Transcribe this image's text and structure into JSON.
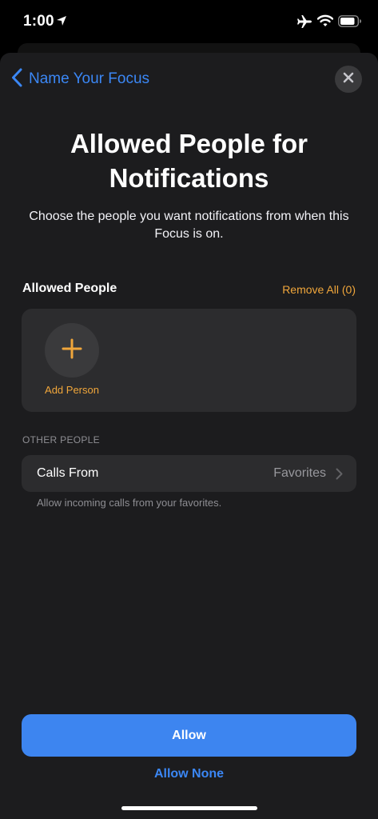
{
  "status_bar": {
    "time": "1:00",
    "icons": [
      "location-arrow-icon",
      "airplane-icon",
      "wifi-icon",
      "battery-icon"
    ]
  },
  "nav": {
    "back_label": "Name Your Focus",
    "back_icon": "chevron-left-icon",
    "close_icon": "close-icon"
  },
  "header": {
    "title": "Allowed People for Notifications",
    "subtitle": "Choose the people you want notifications from when this Focus is on."
  },
  "allowed_people": {
    "label": "Allowed People",
    "remove_all": "Remove All (0)",
    "add_person": "Add Person",
    "add_icon": "plus-icon"
  },
  "other_people": {
    "header": "OTHER PEOPLE",
    "calls_from_label": "Calls From",
    "calls_from_value": "Favorites",
    "footer": "Allow incoming calls from your favorites."
  },
  "actions": {
    "allow": "Allow",
    "allow_none": "Allow None"
  },
  "colors": {
    "accent_blue": "#3b87f5",
    "accent_orange": "#f0a63b",
    "sheet_bg": "#1c1c1e",
    "card_bg": "#2c2c2e"
  }
}
